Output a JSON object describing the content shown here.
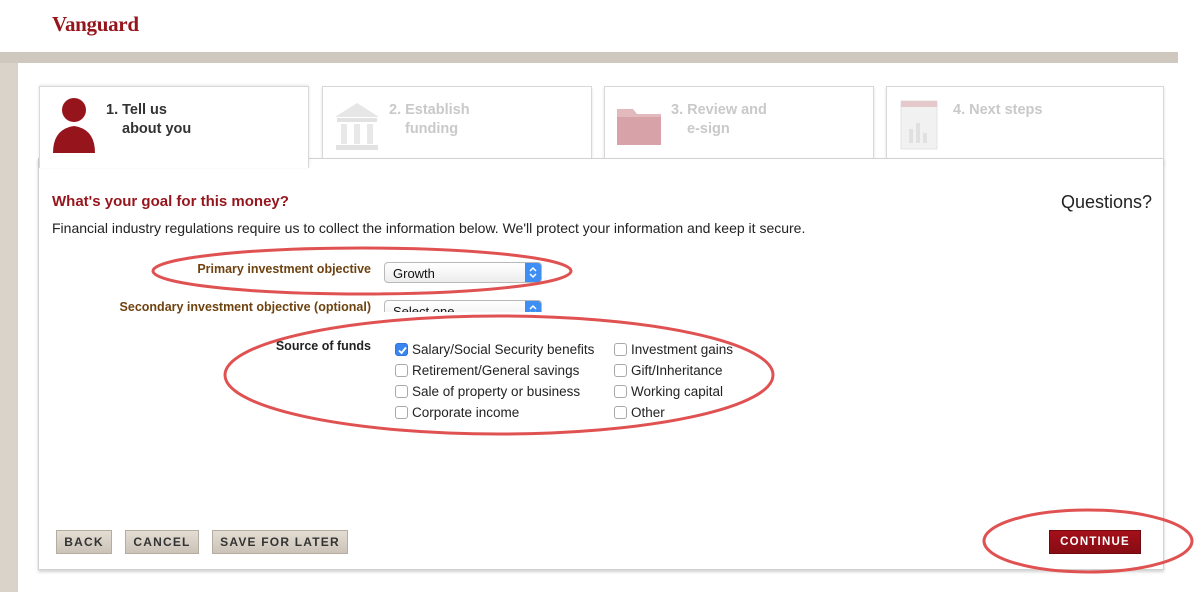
{
  "brand": {
    "logo_text": "Vanguard",
    "color": "#96151d"
  },
  "steps": [
    {
      "line1": "1. Tell us",
      "line2": "about you",
      "icon": "person-icon",
      "state": "active"
    },
    {
      "line1": "2. Establish",
      "line2": "funding",
      "icon": "bank-icon",
      "state": "inactive"
    },
    {
      "line1": "3. Review and",
      "line2": "e-sign",
      "icon": "folder-icon",
      "state": "inactive"
    },
    {
      "line1": "4. Next steps",
      "line2": "",
      "icon": "document-chart-icon",
      "state": "inactive"
    }
  ],
  "form": {
    "heading": "What's your goal for this money?",
    "questions_link": "Questions?",
    "notice": "Financial industry regulations require us to collect the information below. We'll protect your information and keep it secure.",
    "primary": {
      "label": "Primary investment objective",
      "value": "Growth"
    },
    "secondary": {
      "label": "Secondary investment objective (optional)",
      "value": "Select one"
    },
    "source": {
      "label": "Source of funds",
      "options": [
        {
          "label": "Salary/Social Security benefits",
          "checked": true
        },
        {
          "label": "Retirement/General savings",
          "checked": false
        },
        {
          "label": "Sale of property or business",
          "checked": false
        },
        {
          "label": "Corporate income",
          "checked": false
        },
        {
          "label": "Investment gains",
          "checked": false
        },
        {
          "label": "Gift/Inheritance",
          "checked": false
        },
        {
          "label": "Working capital",
          "checked": false
        },
        {
          "label": "Other",
          "checked": false
        }
      ]
    }
  },
  "buttons": {
    "back": "BACK",
    "cancel": "CANCEL",
    "save": "SAVE FOR LATER",
    "continue": "CONTINUE"
  },
  "colors": {
    "accent": "#96151d",
    "annotation": "#e05252",
    "checkbox": "#3a86f0"
  }
}
